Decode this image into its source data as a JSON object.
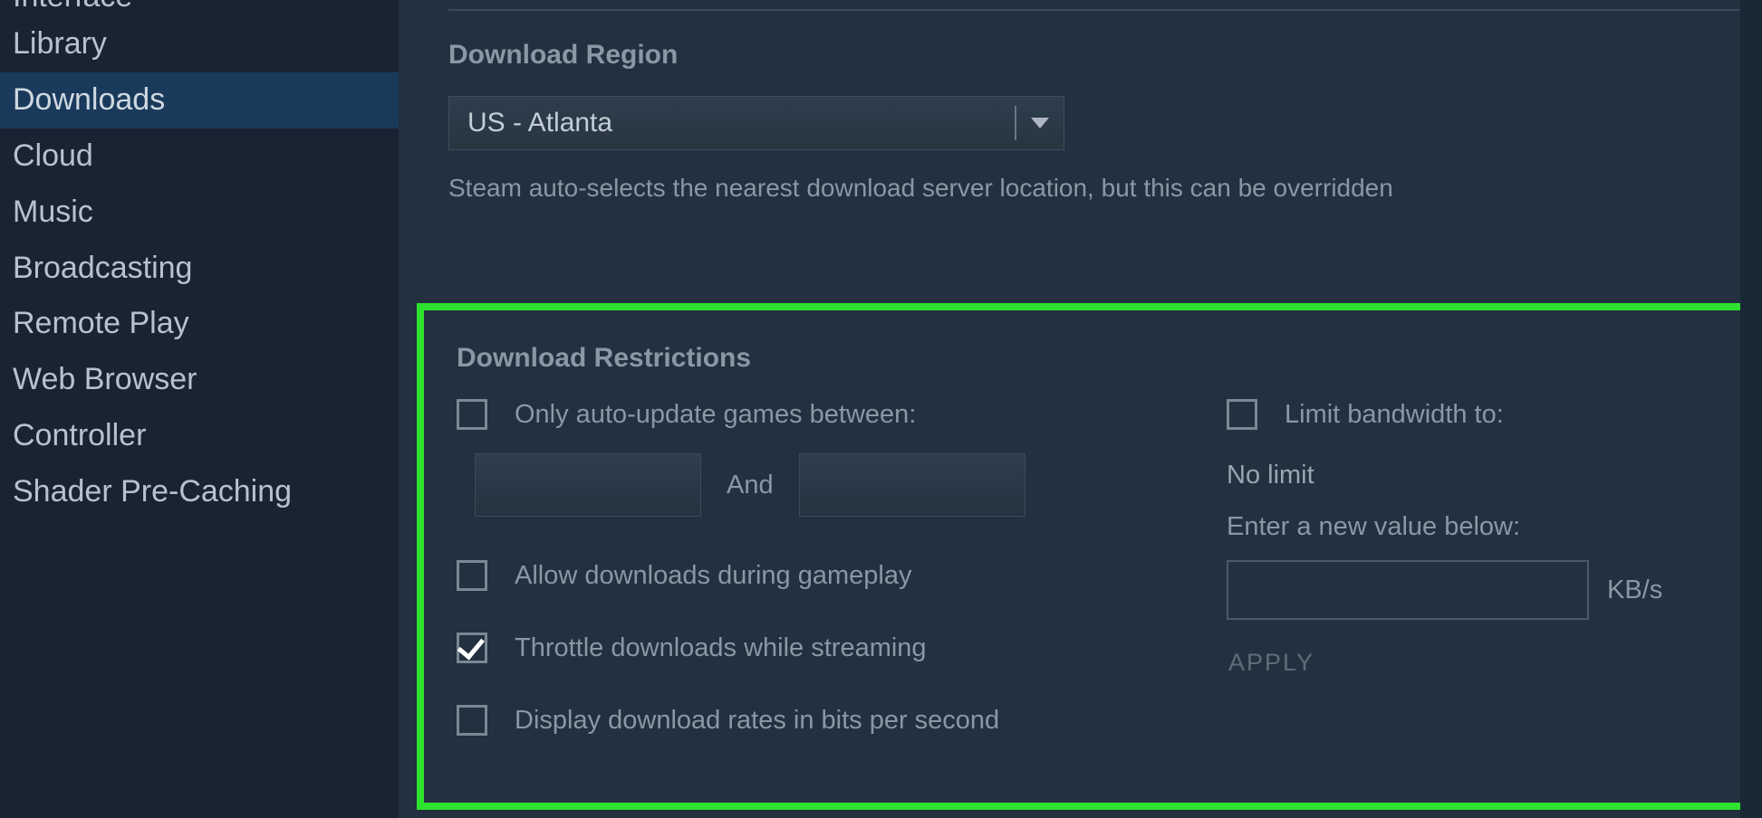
{
  "sidebar": {
    "items": [
      {
        "label": "Interface",
        "active": false,
        "partial": true
      },
      {
        "label": "Library",
        "active": false
      },
      {
        "label": "Downloads",
        "active": true
      },
      {
        "label": "Cloud",
        "active": false
      },
      {
        "label": "Music",
        "active": false
      },
      {
        "label": "Broadcasting",
        "active": false
      },
      {
        "label": "Remote Play",
        "active": false
      },
      {
        "label": "Web Browser",
        "active": false
      },
      {
        "label": "Controller",
        "active": false
      },
      {
        "label": "Shader Pre-Caching",
        "active": false
      }
    ]
  },
  "region": {
    "heading": "Download Region",
    "selected": "US - Atlanta",
    "helper": "Steam auto-selects the nearest download server location, but this can be overridden"
  },
  "restrictions": {
    "heading": "Download Restrictions",
    "auto_update_between": {
      "label": "Only auto-update games between:",
      "checked": false
    },
    "and_label": "And",
    "allow_during_gameplay": {
      "label": "Allow downloads during gameplay",
      "checked": false
    },
    "throttle_streaming": {
      "label": "Throttle downloads while streaming",
      "checked": true
    },
    "display_bits": {
      "label": "Display download rates in bits per second",
      "checked": false
    },
    "limit_bandwidth": {
      "label": "Limit bandwidth to:",
      "checked": false
    },
    "no_limit": "No limit",
    "enter_new_value": "Enter a new value below:",
    "unit": "KB/s",
    "apply": "APPLY"
  }
}
